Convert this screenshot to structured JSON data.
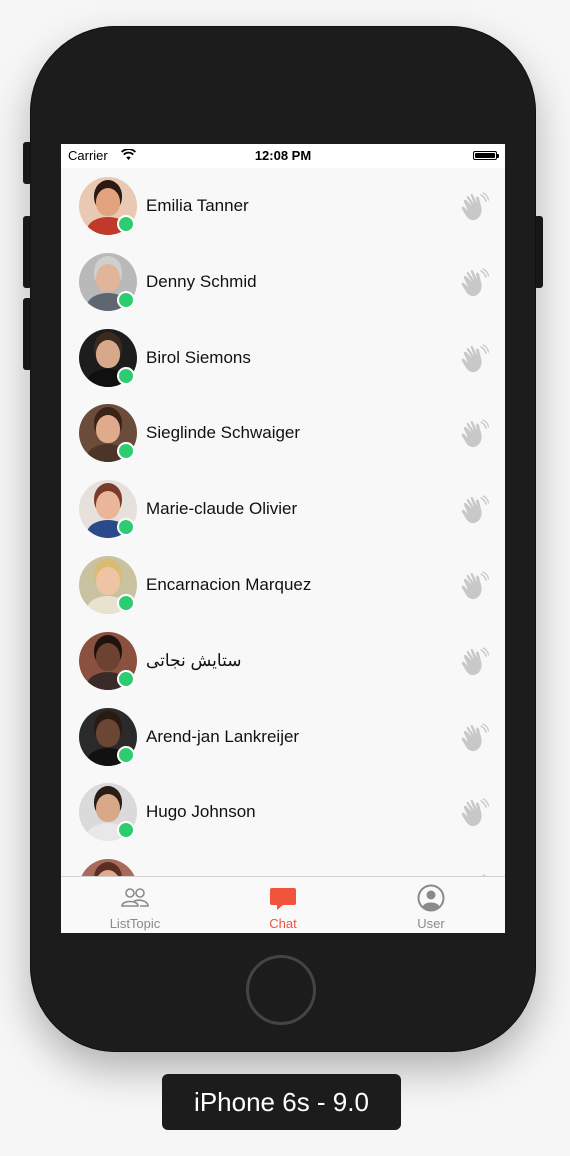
{
  "status_bar": {
    "carrier": "Carrier",
    "time": "12:08 PM"
  },
  "contacts": [
    {
      "name": "Emilia Tanner",
      "avatar_bg": "#e9c9b3",
      "skin": "#e2a37e",
      "hair": "#2a1a12",
      "shirt": "#c0392b",
      "online": true
    },
    {
      "name": "Denny Schmid",
      "avatar_bg": "#b9b9b9",
      "skin": "#e1b59a",
      "hair": "#cfcfcf",
      "shirt": "#5e6670",
      "online": true
    },
    {
      "name": "Birol Siemons",
      "avatar_bg": "#1d1d1d",
      "skin": "#d7a98a",
      "hair": "#3a2a20",
      "shirt": "#101010",
      "online": true
    },
    {
      "name": "Sieglinde Schwaiger",
      "avatar_bg": "#6b4b3a",
      "skin": "#e0ab8c",
      "hair": "#3a2418",
      "shirt": "#4c3428",
      "online": true
    },
    {
      "name": "Marie-claude Olivier",
      "avatar_bg": "#e6e1dc",
      "skin": "#eab69a",
      "hair": "#7a3b2a",
      "shirt": "#2b4a8a",
      "online": true
    },
    {
      "name": "Encarnacion Marquez",
      "avatar_bg": "#c9c2a0",
      "skin": "#efc4a5",
      "hair": "#d9bb72",
      "shirt": "#e9e2cf",
      "online": true
    },
    {
      "name": "ستایش نجاتی",
      "avatar_bg": "#8a5040",
      "skin": "#6e4230",
      "hair": "#1e130e",
      "shirt": "#3a2a28",
      "online": true
    },
    {
      "name": "Arend-jan Lankreijer",
      "avatar_bg": "#2a2a2a",
      "skin": "#6b4634",
      "hair": "#2a1a12",
      "shirt": "#111111",
      "online": true
    },
    {
      "name": "Hugo Johnson",
      "avatar_bg": "#dadada",
      "skin": "#d9a888",
      "hair": "#2a1d16",
      "shirt": "#e8e8e8",
      "online": true
    },
    {
      "name": "",
      "avatar_bg": "#a86a5a",
      "skin": "#e0ab8c",
      "hair": "#5a2e22",
      "shirt": "#6b3b30",
      "online": false
    }
  ],
  "tabs": [
    {
      "label": "ListTopic",
      "icon": "people-icon",
      "active": false
    },
    {
      "label": "Chat",
      "icon": "chat-bubble-icon",
      "active": true
    },
    {
      "label": "User",
      "icon": "user-circle-icon",
      "active": false
    }
  ],
  "colors": {
    "accent": "#f0543c",
    "online": "#2ecc71",
    "wave": "#c8c8c8",
    "tab_inactive": "#8a8a8a"
  },
  "device_label": "iPhone 6s - 9.0"
}
